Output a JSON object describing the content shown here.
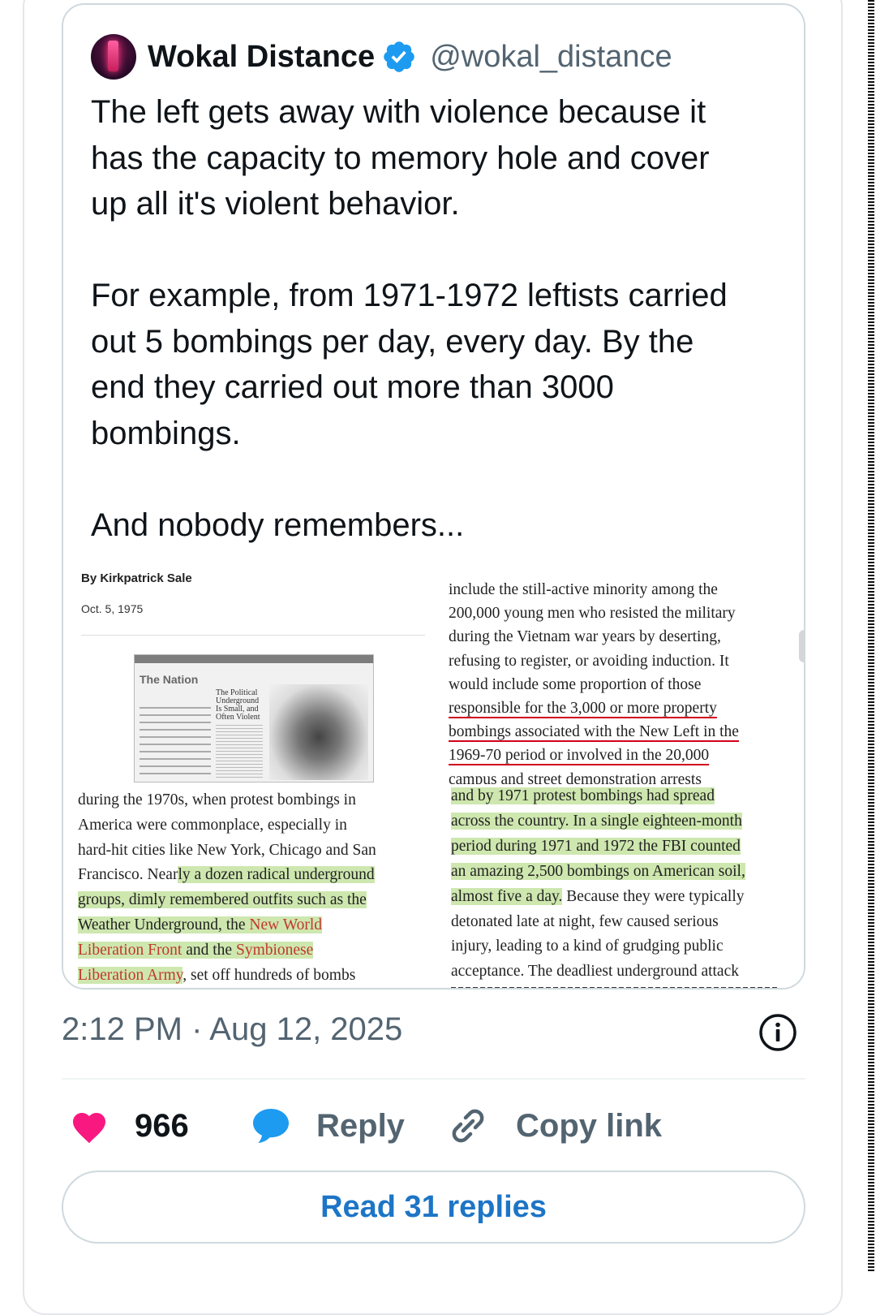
{
  "quoted_post": {
    "author_name": "Wokal Distance",
    "handle": "@wokal_distance",
    "text": "The left gets away with violence because it\nhas the capacity to memory hole and cover\nup all it's violent behavior.\n\nFor example, from 1971-1972 leftists carried\nout 5 bombings per day, every day. By the\nend they carried out more than 3000\nbombings.\n\nAnd nobody remembers..."
  },
  "article": {
    "byline": "By Kirkpatrick Sale",
    "date": "Oct. 5, 1975",
    "thumbnail": {
      "masthead": "The Nation",
      "headline": "The Political Underground Is Small, and Often Violent"
    },
    "left_column": {
      "l1": "during the 1970s, when protest bombings in",
      "l2": "America were commonplace, especially in",
      "l3": "hard-hit cities like New York, Chicago and San",
      "l4a": "Francisco. Near",
      "l4b": "ly a dozen radical underground",
      "l5": "groups, dimly remembered outfits such as the",
      "l6a": "Weather Underground, the ",
      "l6b": "New World",
      "l7a": "Liberation Front",
      "l7b": " and the ",
      "l7c": "Symbionese",
      "l8a": "Liberation Army",
      "l8b": ", set off hundreds of bombs"
    },
    "right_column_top": {
      "l1": "include the still-active minority among the",
      "l2": "200,000 young men who resisted the military",
      "l3": "during the Vietnam war years by deserting,",
      "l4": "refusing to register, or avoiding induction. It",
      "l5": "would include some proportion of those",
      "l6": "responsible for the 3,000 or more property",
      "l7": "bombings associated with the New Left in the",
      "l8": "1969-70 period or involved in the 20,000",
      "l9": "campus and street demonstration arrests"
    },
    "right_column_bottom": {
      "l1": "and by 1971 protest bombings had spread",
      "l2": "across the country. In a single eighteen-month",
      "l3": "period during 1971 and 1972 the FBI counted",
      "l4": "an amazing 2,500 bombings on American soil,",
      "l5a": "almost five a day.",
      "l5b": " Because they were typically",
      "l6": "detonated late at night, few caused serious",
      "l7": "injury, leading to a kind of grudging public",
      "l8": "acceptance. The deadliest underground attack"
    }
  },
  "post_meta": {
    "timestamp": "2:12 PM · Aug 12, 2025"
  },
  "actions": {
    "like_count": "966",
    "reply_label": "Reply",
    "copy_link_label": "Copy link"
  },
  "read_replies_label": "Read 31 replies",
  "icons": {
    "verified": "verified-badge-icon",
    "info": "info-icon",
    "like": "heart-icon",
    "reply": "speech-bubble-icon",
    "copy_link": "link-icon"
  },
  "colors": {
    "like": "#f91880",
    "reply": "#1d9bf0",
    "verified": "#1d9bf0",
    "link_text": "#1d75c6",
    "highlight": "#a5d46e",
    "underline": "#d0021b"
  }
}
